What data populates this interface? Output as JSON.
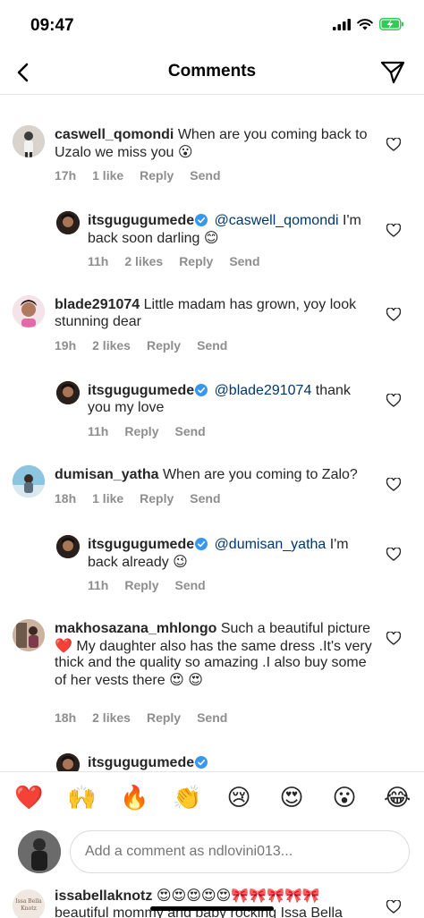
{
  "status": {
    "time": "09:47"
  },
  "header": {
    "title": "Comments"
  },
  "comments": [
    {
      "user": "caswell_qomondi",
      "text": "When are you coming back to Uzalo we miss you",
      "emoji": "😮",
      "time": "17h",
      "likes": "1 like",
      "reply": "Reply",
      "send": "Send"
    },
    {
      "user": "itsgugugumede",
      "mention": "@caswell_qomondi",
      "text": "I'm back soon darling",
      "emoji": "😊",
      "time": "11h",
      "likes": "2 likes",
      "reply": "Reply",
      "send": "Send"
    },
    {
      "user": "blade291074",
      "text": "Little madam has grown,  yoy look stunning dear",
      "time": "19h",
      "likes": "2 likes",
      "reply": "Reply",
      "send": "Send"
    },
    {
      "user": "itsgugugumede",
      "mention": "@blade291074",
      "text": "thank you my love",
      "time": "11h",
      "reply": "Reply",
      "send": "Send"
    },
    {
      "user": "dumisan_yatha",
      "text": "When are you coming to Zalo?",
      "time": "18h",
      "likes": "1 like",
      "reply": "Reply",
      "send": "Send"
    },
    {
      "user": "itsgugugumede",
      "mention": "@dumisan_yatha",
      "text": "I'm back already",
      "emoji": "😉",
      "time": "11h",
      "reply": "Reply",
      "send": "Send"
    },
    {
      "user": "makhosazana_mhlongo",
      "text_a": "Such a beautiful picture",
      "emoji_a": "❤️",
      "text_b": "My daughter also has the same dress .It's very thick and the quality so amazing .I also buy some of her vests there",
      "emoji_b": "😍",
      "emoji_c": "😍",
      "time": "18h",
      "likes": "2 likes",
      "reply": "Reply",
      "send": "Send"
    },
    {
      "user": "itsgugugumede"
    }
  ],
  "reactions": [
    "❤️",
    "🙌",
    "🔥",
    "👏",
    "😢",
    "😍",
    "😮",
    "😂"
  ],
  "composer": {
    "placeholder": "Add a comment as ndlovini013..."
  },
  "peek": {
    "user": "issabellaknotz",
    "emojis": "😍😍😍😍😍🎀🎀🎀🎀🎀",
    "text": "beautiful mommy and baby rocking Issa Bella",
    "avatar_text": "Issa Bella Knotz"
  },
  "colors": {
    "verified": "#3897f0",
    "mention": "#00376b",
    "muted": "#8e8e8e"
  }
}
